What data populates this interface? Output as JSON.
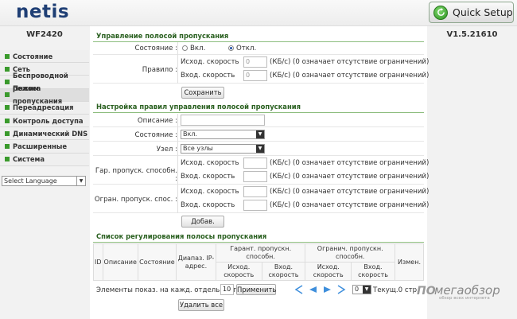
{
  "header": {
    "logo": "netis",
    "quick_setup": "Quick Setup",
    "model": "WF2420",
    "version": "V1.5.21610"
  },
  "sidebar": {
    "items": [
      {
        "label": "Состояние"
      },
      {
        "label": "Сеть"
      },
      {
        "label": "Беспроводной режим"
      },
      {
        "label": "Полоса пропускания"
      },
      {
        "label": "Переадресация"
      },
      {
        "label": "Контроль доступа"
      },
      {
        "label": "Динамический DNS"
      },
      {
        "label": "Расширенные"
      },
      {
        "label": "Система"
      }
    ],
    "language": "Select Language"
  },
  "bandwidth": {
    "title": "Управление полосой пропускания",
    "state_label": "Состояние :",
    "on_label": "Вкл.",
    "off_label": "Откл.",
    "rule_label": "Правило :",
    "up_label": "Исход. скорость",
    "down_label": "Вход. скорость",
    "up_value": "0",
    "down_value": "0",
    "hint": "(КБ/с) (0 означает отсутствие ограничений)",
    "save": "Сохранить"
  },
  "rules": {
    "title": "Настройка правил управления полосой пропускания",
    "desc_label": "Описание :",
    "state_label": "Состояние :",
    "state_value": "Вкл.",
    "node_label": "Узел :",
    "node_value": "Все узлы",
    "guar_label": "Гар. пропуск. способн. :",
    "limit_label": "Огран. пропуск. спос. :",
    "up_label": "Исход. скорость",
    "down_label": "Вход. скорость",
    "hint": "(КБ/с) (0 означает отсутствие ограничений)",
    "add": "Добав."
  },
  "list": {
    "title": "Список регулирования полосы пропускания",
    "col_id": "ID",
    "col_desc": "Описание",
    "col_state": "Состояние",
    "col_ip": "Диапаз. IP-адрес.",
    "col_guar": "Гарант. пропускн. способн.",
    "col_limit": "Огранич. пропускн. способн.",
    "col_edit": "Измен.",
    "sub_up": "Исход. скорость",
    "sub_down": "Вход. скорость",
    "per_page_label": "Элементы показ. на кажд. отдельн. стр.",
    "per_page_value": "10",
    "apply": "Применить",
    "page_value": "0",
    "current": "Текущ.0 стр.",
    "delete_all": "Удалить все"
  },
  "watermark": {
    "logo": "ПО",
    "main": "мегаобзор",
    "sub": "обзор всех интернета"
  },
  "colors": {
    "brand_blue": "#1f3f75",
    "accent_green": "#3a9a2c",
    "section_title": "#2a6020",
    "pager_arrow": "#3f8fdc"
  }
}
